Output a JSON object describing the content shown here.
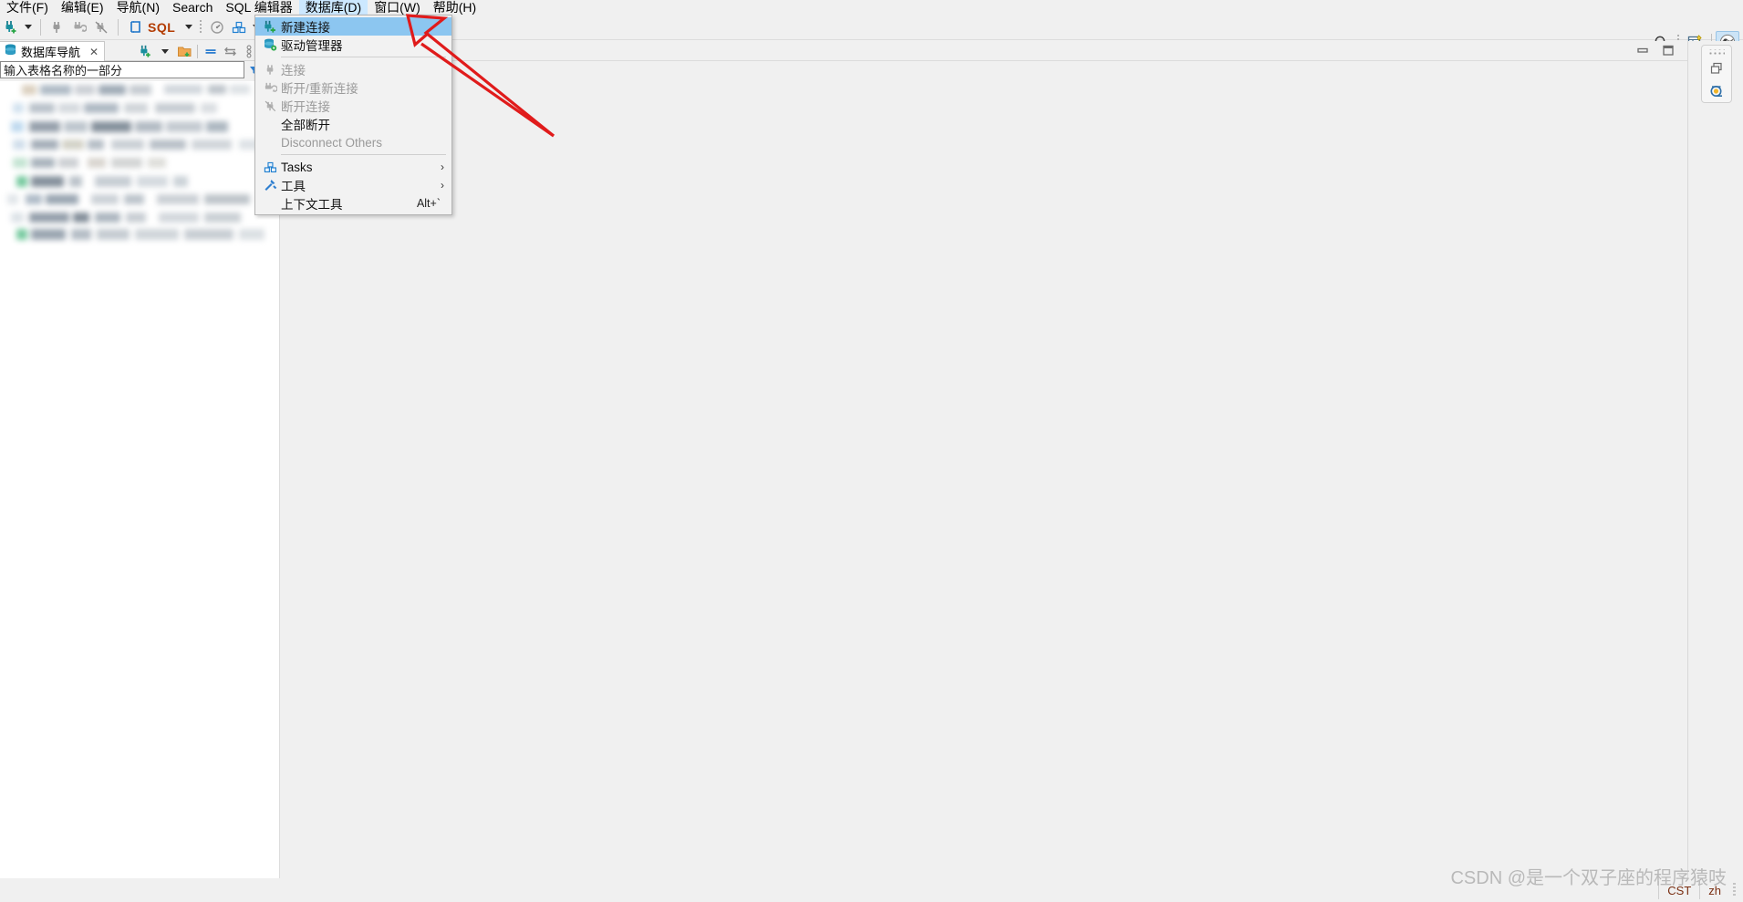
{
  "app": {
    "title": "DBeaver",
    "accent_blue": "#8cc6f0",
    "menu_highlight": "#cce8ff",
    "annotation_color": "#e01b1b"
  },
  "menubar": {
    "items": [
      {
        "label": "文件(F)",
        "active": false
      },
      {
        "label": "编辑(E)",
        "active": false
      },
      {
        "label": "导航(N)",
        "active": false
      },
      {
        "label": "Search",
        "active": false
      },
      {
        "label": "SQL 编辑器",
        "active": false
      },
      {
        "label": "数据库(D)",
        "active": true
      },
      {
        "label": "窗口(W)",
        "active": false
      },
      {
        "label": "帮助(H)",
        "active": false
      }
    ]
  },
  "toolbar": {
    "new_connection_icon": "plug-plus-icon",
    "connect_icon": "plug-icon",
    "reconnect_icon": "plug-refresh-icon",
    "disconnect_icon": "plug-disconnect-icon",
    "sql_editor_label": "SQL",
    "dashboard_icon": "gauge-icon",
    "tasks_icon": "tasks-icon",
    "script_icon": "pencil-icon",
    "search_icon": "search-icon",
    "new_window_icon": "new-window-icon",
    "perspective_icon": "perspective-avatar-icon"
  },
  "dropdown": {
    "title": "数据库(D)",
    "items": [
      {
        "label": "新建连接",
        "icon": "plug-plus-icon",
        "selected": true,
        "disabled": false,
        "accel": "",
        "submenu": false
      },
      {
        "label": "驱动管理器",
        "icon": "database-gear-icon",
        "selected": false,
        "disabled": false,
        "accel": "",
        "submenu": false
      },
      {
        "separator": true
      },
      {
        "label": "连接",
        "icon": "plug-icon",
        "selected": false,
        "disabled": true,
        "accel": "",
        "submenu": false
      },
      {
        "label": "断开/重新连接",
        "icon": "plug-refresh-icon",
        "selected": false,
        "disabled": true,
        "accel": "",
        "submenu": false
      },
      {
        "label": "断开连接",
        "icon": "plug-disconnect-icon",
        "selected": false,
        "disabled": true,
        "accel": "",
        "submenu": false
      },
      {
        "label": "全部断开",
        "icon": "",
        "selected": false,
        "disabled": false,
        "accel": "",
        "submenu": false
      },
      {
        "label": "Disconnect Others",
        "icon": "",
        "selected": false,
        "disabled": true,
        "accel": "",
        "submenu": false
      },
      {
        "separator": true
      },
      {
        "label": "Tasks",
        "icon": "tasks-icon",
        "selected": false,
        "disabled": false,
        "accel": "",
        "submenu": true
      },
      {
        "label": "工具",
        "icon": "tools-icon",
        "selected": false,
        "disabled": false,
        "accel": "",
        "submenu": true
      },
      {
        "label": "上下文工具",
        "icon": "",
        "selected": false,
        "disabled": false,
        "accel": "Alt+`",
        "submenu": false
      }
    ]
  },
  "left_panel": {
    "tab_label": "数据库导航",
    "tab_close": "✕",
    "filter_placeholder": "输入表格名称的一部分",
    "tools": [
      {
        "name": "new-connection-icon"
      },
      {
        "name": "dropdown-arrow-icon"
      },
      {
        "name": "new-folder-icon"
      },
      {
        "name": "collapse-all-icon"
      },
      {
        "name": "link-editor-icon"
      },
      {
        "name": "view-menu-icon"
      },
      {
        "name": "minimize-icon"
      }
    ],
    "tree_note": "censored-blurred-tree-content"
  },
  "editor": {
    "minimize_label": "minimize-icon",
    "maximize_label": "maximize-icon"
  },
  "right_rail": {
    "items": [
      {
        "name": "restore-perspective-icon"
      },
      {
        "name": "database-navigator-icon"
      }
    ]
  },
  "statusbar": {
    "timezone": "CST",
    "locale": "zh",
    "watermark": "CSDN @是一个双子座的程序猿吱"
  }
}
